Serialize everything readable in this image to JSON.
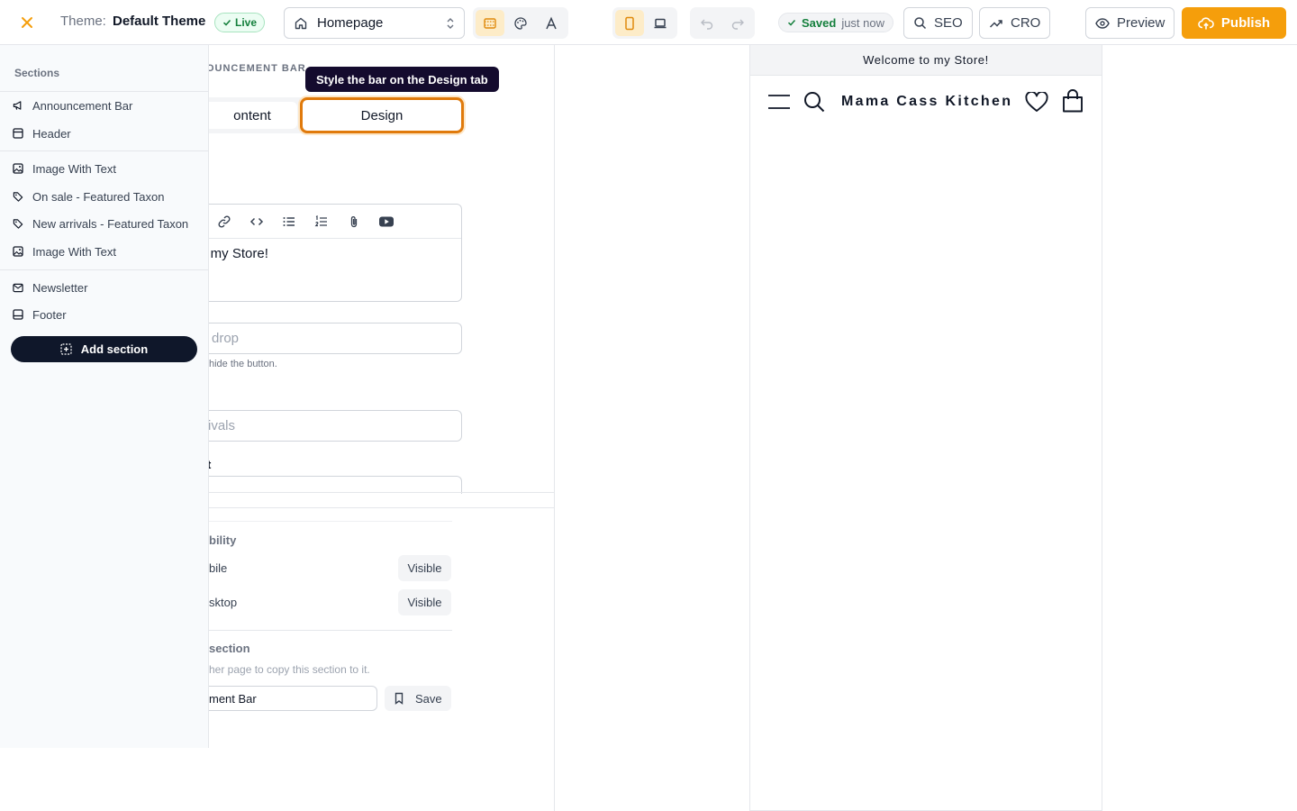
{
  "topbar": {
    "theme_label": "Theme:",
    "theme_name": "Default Theme",
    "live_badge": "Live",
    "page_select": "Homepage",
    "saved_status": "Saved",
    "saved_time": "just now",
    "seo_label": "SEO",
    "cro_label": "CRO",
    "preview_label": "Preview",
    "publish_label": "Publish",
    "accent_color": "#f59e0b"
  },
  "editor": {
    "section_title": "NOUNCEMENT BAR",
    "tooltip": "Style the bar on the Design tab",
    "tabs": [
      "ontent",
      "Design"
    ],
    "active_tab": "Design",
    "rte_text": "to my Store!",
    "input1_placeholder": "drop",
    "input1_help": "hide the button.",
    "input2_placeholder": "ivals",
    "field_label": "t",
    "visibility_title": "bility",
    "visibility_rows": [
      {
        "label": "bile",
        "value": "Visible"
      },
      {
        "label": "sktop",
        "value": "Visible"
      }
    ],
    "copy_title": "section",
    "copy_help": "her page to copy this section to it.",
    "copy_value": "ment Bar",
    "save_label": "Save"
  },
  "sidebar": {
    "heading": "Sections",
    "items": [
      {
        "label": "Announcement Bar",
        "icon": "megaphone-icon"
      },
      {
        "label": "Header",
        "icon": "layout-header-icon"
      },
      {
        "label": "Image With Text",
        "icon": "image-icon"
      },
      {
        "label": "On sale - Featured Taxon",
        "icon": "tag-icon"
      },
      {
        "label": "New arrivals - Featured Taxon",
        "icon": "tag-icon"
      },
      {
        "label": "Image With Text",
        "icon": "image-icon"
      },
      {
        "label": "Newsletter",
        "icon": "mail-icon"
      },
      {
        "label": "Footer",
        "icon": "layout-footer-icon"
      }
    ],
    "add_section_label": "Add section"
  },
  "preview": {
    "announcement": "Welcome to my Store!",
    "store_name": "Mama Cass Kitchen"
  }
}
